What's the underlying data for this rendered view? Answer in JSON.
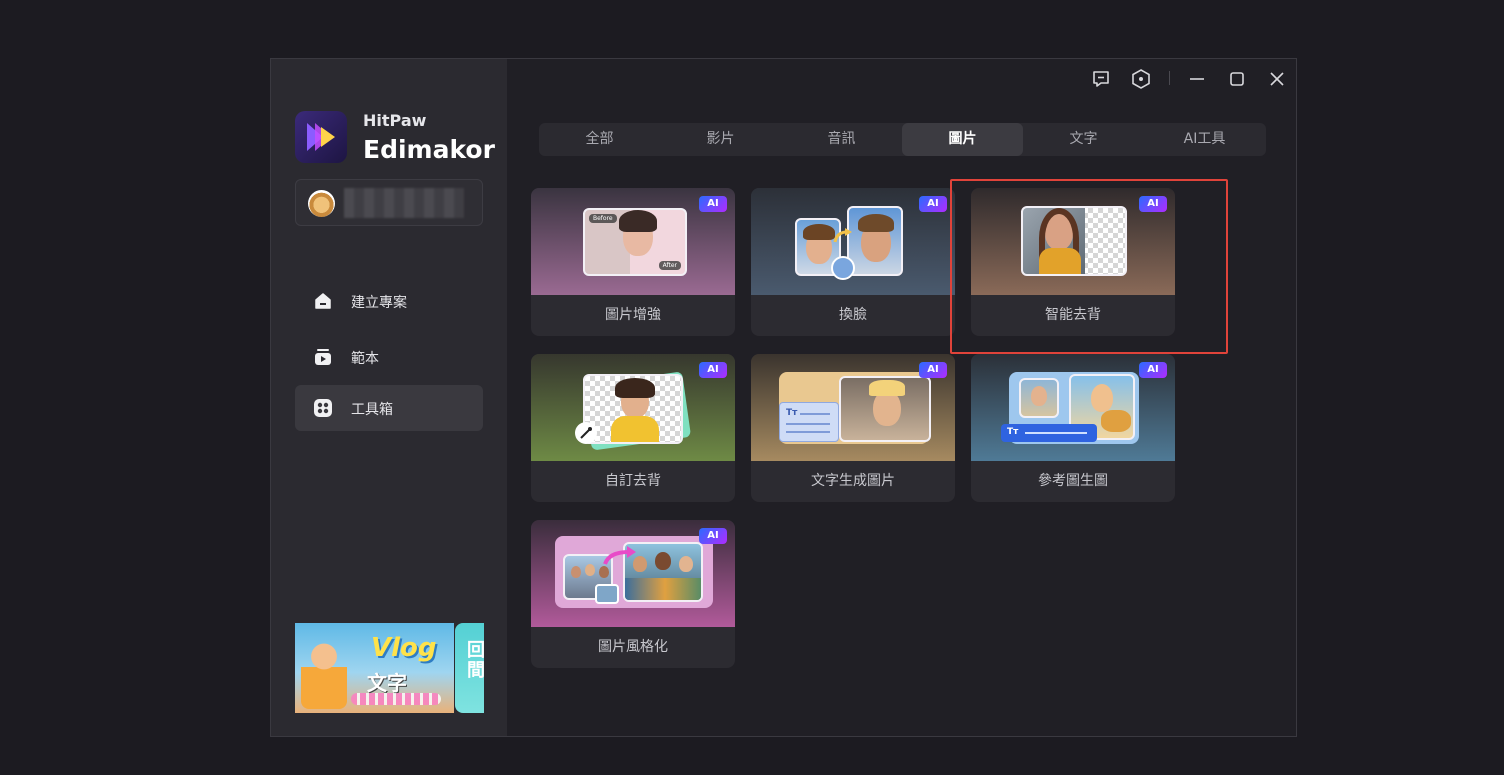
{
  "app": {
    "brand_sub": "HitPaw",
    "brand_name": "Edimakor"
  },
  "sidebar": {
    "items": [
      {
        "label": "建立專案",
        "icon": "home-icon"
      },
      {
        "label": "範本",
        "icon": "template-icon"
      },
      {
        "label": "工具箱",
        "icon": "toolbox-icon",
        "active": true
      }
    ],
    "banner": {
      "title": "Vlog",
      "subtitle": "文字"
    }
  },
  "window_controls": [
    "feedback-icon",
    "settings-icon",
    "minimize-icon",
    "maximize-icon",
    "close-icon"
  ],
  "tabs": [
    {
      "label": "全部"
    },
    {
      "label": "影片"
    },
    {
      "label": "音訊"
    },
    {
      "label": "圖片",
      "active": true
    },
    {
      "label": "文字"
    },
    {
      "label": "AI工具"
    }
  ],
  "tools": [
    {
      "label": "圖片增強",
      "badge": "AI",
      "before": "Before",
      "after": "After"
    },
    {
      "label": "換臉",
      "badge": "AI"
    },
    {
      "label": "智能去背",
      "badge": "AI",
      "highlighted": true
    },
    {
      "label": "自訂去背",
      "badge": "AI"
    },
    {
      "label": "文字生成圖片",
      "badge": "AI"
    },
    {
      "label": "參考圖生圖",
      "badge": "AI"
    },
    {
      "label": "圖片風格化",
      "badge": "AI"
    }
  ],
  "colors": {
    "highlight": "#e0433a",
    "ai_badge_start": "#2b6bff",
    "ai_badge_end": "#b02bff"
  }
}
